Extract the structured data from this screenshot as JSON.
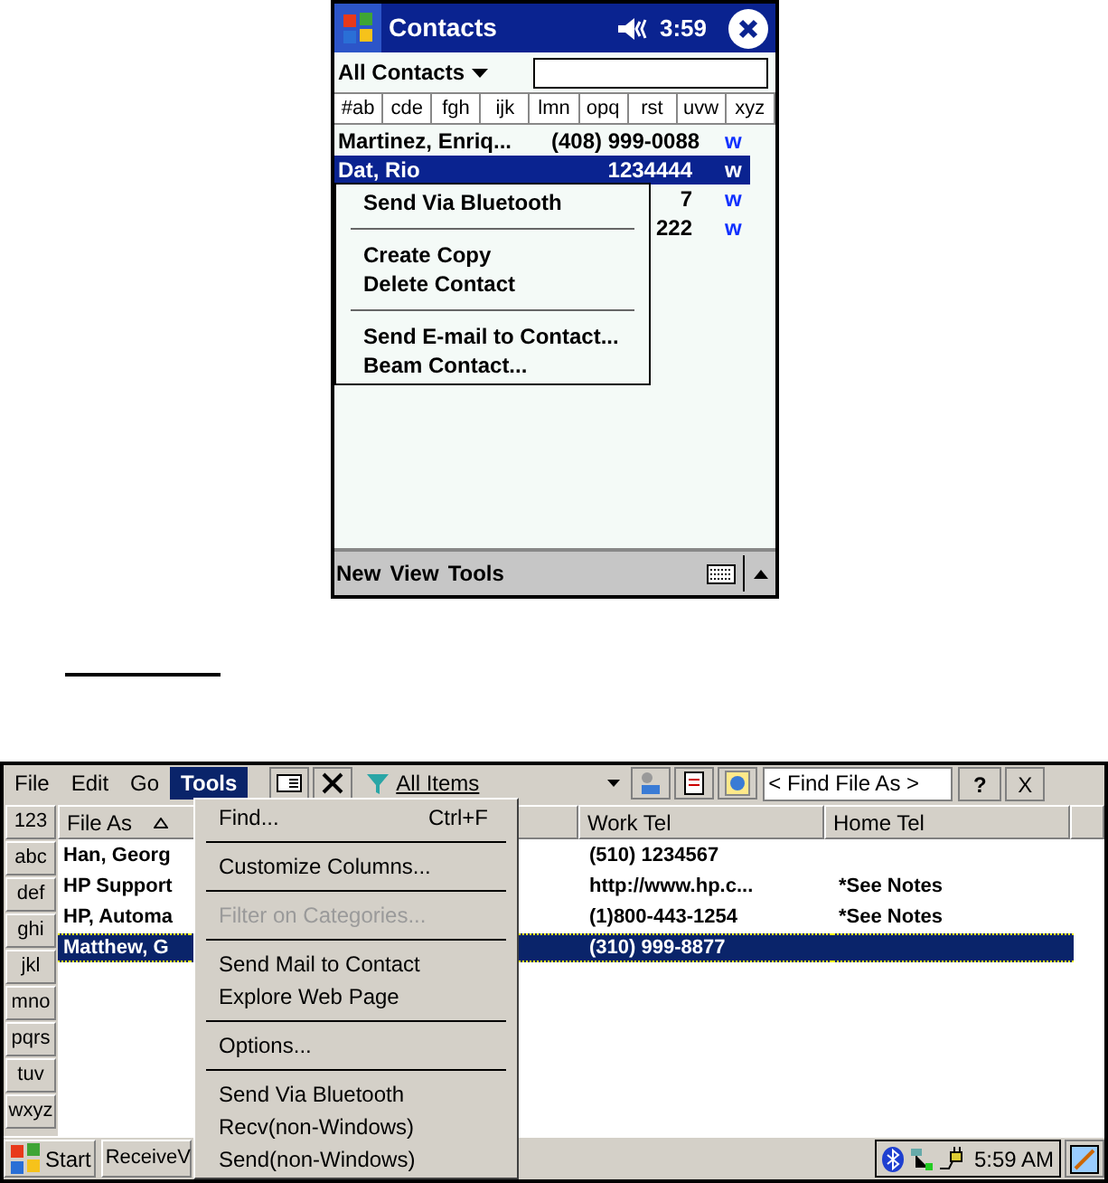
{
  "pocket_pc": {
    "title_bar": {
      "title": "Contacts",
      "time": "3:59"
    },
    "filter": {
      "label": "All Contacts"
    },
    "letter_tabs": [
      "#ab",
      "cde",
      "fgh",
      "ijk",
      "lmn",
      "opq",
      "rst",
      "uvw",
      "xyz"
    ],
    "rows": [
      {
        "name": "Martinez, Enriq...",
        "phone": "(408) 999-0088",
        "tag": "w",
        "selected": false
      },
      {
        "name": "Dat, Rio",
        "phone": "1234444",
        "tag": "w",
        "selected": true
      },
      {
        "phone": "7",
        "tag": "w",
        "selected": false
      },
      {
        "phone": "222",
        "tag": "w",
        "selected": false
      }
    ],
    "context_menu": [
      {
        "kind": "item",
        "label": "Send Via Bluetooth"
      },
      {
        "kind": "separator"
      },
      {
        "kind": "item",
        "label": "Create Copy"
      },
      {
        "kind": "item",
        "label": "Delete Contact"
      },
      {
        "kind": "separator"
      },
      {
        "kind": "item",
        "label": "Send E-mail to Contact..."
      },
      {
        "kind": "item",
        "label": "Beam Contact..."
      }
    ],
    "menu_bar": [
      "New",
      "View",
      "Tools"
    ]
  },
  "handheld_pc": {
    "menu_bar": [
      {
        "label": "File",
        "selected": false
      },
      {
        "label": "Edit",
        "selected": false
      },
      {
        "label": "Go",
        "selected": false
      },
      {
        "label": "Tools",
        "selected": true
      }
    ],
    "toolbar": {
      "filter": "All Items",
      "search": {
        "placeholder": "< Find File As >"
      },
      "help": "?",
      "close": "X"
    },
    "letter_buttons": [
      "123",
      "abc",
      "def",
      "ghi",
      "jkl",
      "mno",
      "pqrs",
      "tuv",
      "wxyz"
    ],
    "columns": [
      "File As",
      "Work Tel",
      "Home Tel"
    ],
    "rows": [
      {
        "file_as": "Han, Georg",
        "work_tel": "(510) 1234567",
        "selected": false
      },
      {
        "file_as": "HP Support",
        "work_tel": "http://www.hp.c...",
        "home_tel": "*See Notes",
        "selected": false
      },
      {
        "file_as": "HP, Automa",
        "work_tel": "(1)800-443-1254",
        "home_tel": "*See Notes",
        "selected": false
      },
      {
        "file_as": "Matthew, G",
        "work_tel": "(310) 999-8877",
        "selected": true
      }
    ],
    "tools_menu": [
      {
        "kind": "item",
        "label": "Find...",
        "shortcut": "Ctrl+F",
        "disabled": false
      },
      {
        "kind": "separator"
      },
      {
        "kind": "item",
        "label": "Customize Columns...",
        "disabled": false
      },
      {
        "kind": "separator"
      },
      {
        "kind": "item",
        "label": "Filter on Categories...",
        "disabled": true
      },
      {
        "kind": "separator"
      },
      {
        "kind": "item",
        "label": "Send Mail to Contact",
        "disabled": false
      },
      {
        "kind": "item",
        "label": "Explore Web Page",
        "disabled": false
      },
      {
        "kind": "separator"
      },
      {
        "kind": "item",
        "label": "Options...",
        "disabled": false
      },
      {
        "kind": "separator"
      },
      {
        "kind": "item",
        "label": "Send Via Bluetooth",
        "disabled": false
      },
      {
        "kind": "item",
        "label": "Recv(non-Windows)",
        "disabled": false
      },
      {
        "kind": "item",
        "label": "Send(non-Windows)",
        "disabled": false
      }
    ],
    "taskbar": {
      "start": "Start",
      "task": "ReceiveV",
      "time": "5:59 AM"
    }
  }
}
